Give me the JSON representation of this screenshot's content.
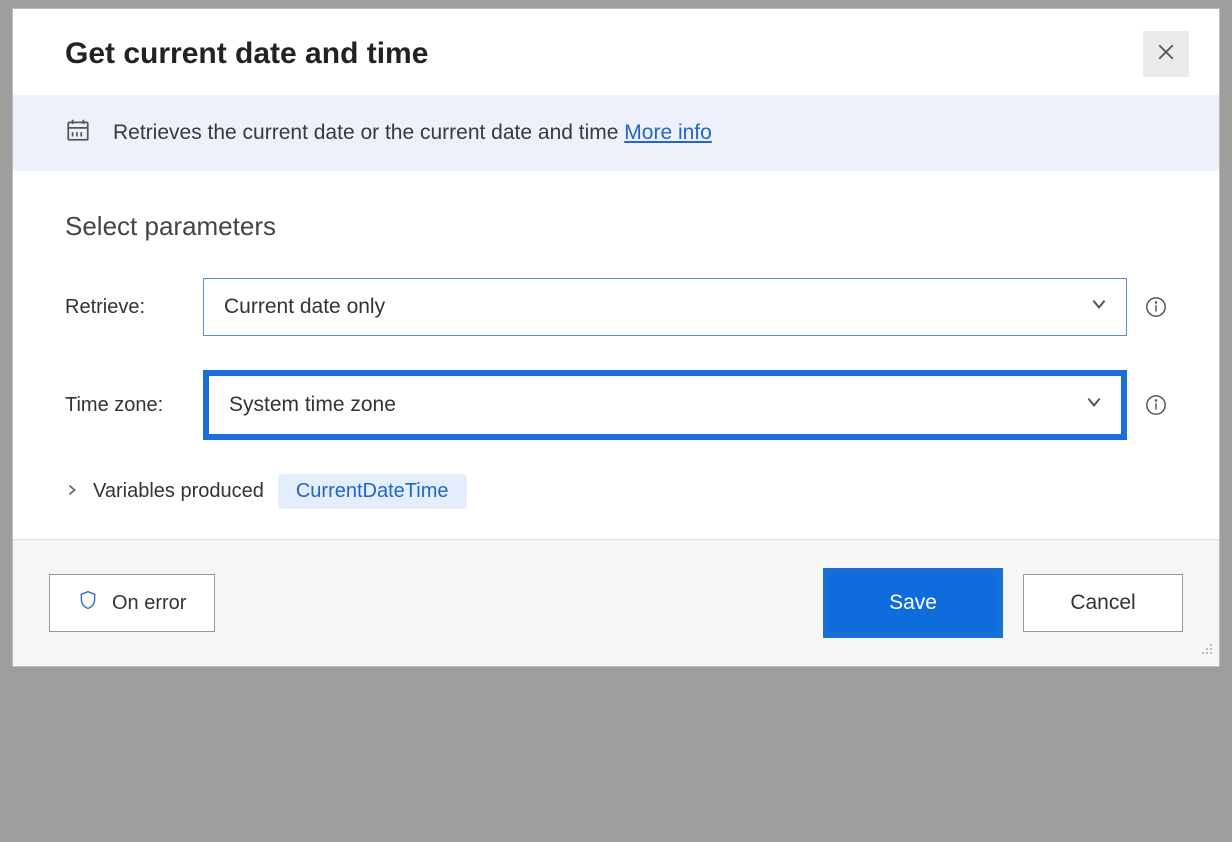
{
  "dialog": {
    "title": "Get current date and time",
    "info_text": "Retrieves the current date or the current date and time",
    "more_info_label": "More info",
    "section_title": "Select parameters",
    "fields": {
      "retrieve": {
        "label": "Retrieve:",
        "value": "Current date only"
      },
      "timezone": {
        "label": "Time zone:",
        "value": "System time zone"
      }
    },
    "variables_produced": {
      "label": "Variables produced",
      "var": "CurrentDateTime"
    },
    "footer": {
      "on_error": "On error",
      "save": "Save",
      "cancel": "Cancel"
    }
  }
}
